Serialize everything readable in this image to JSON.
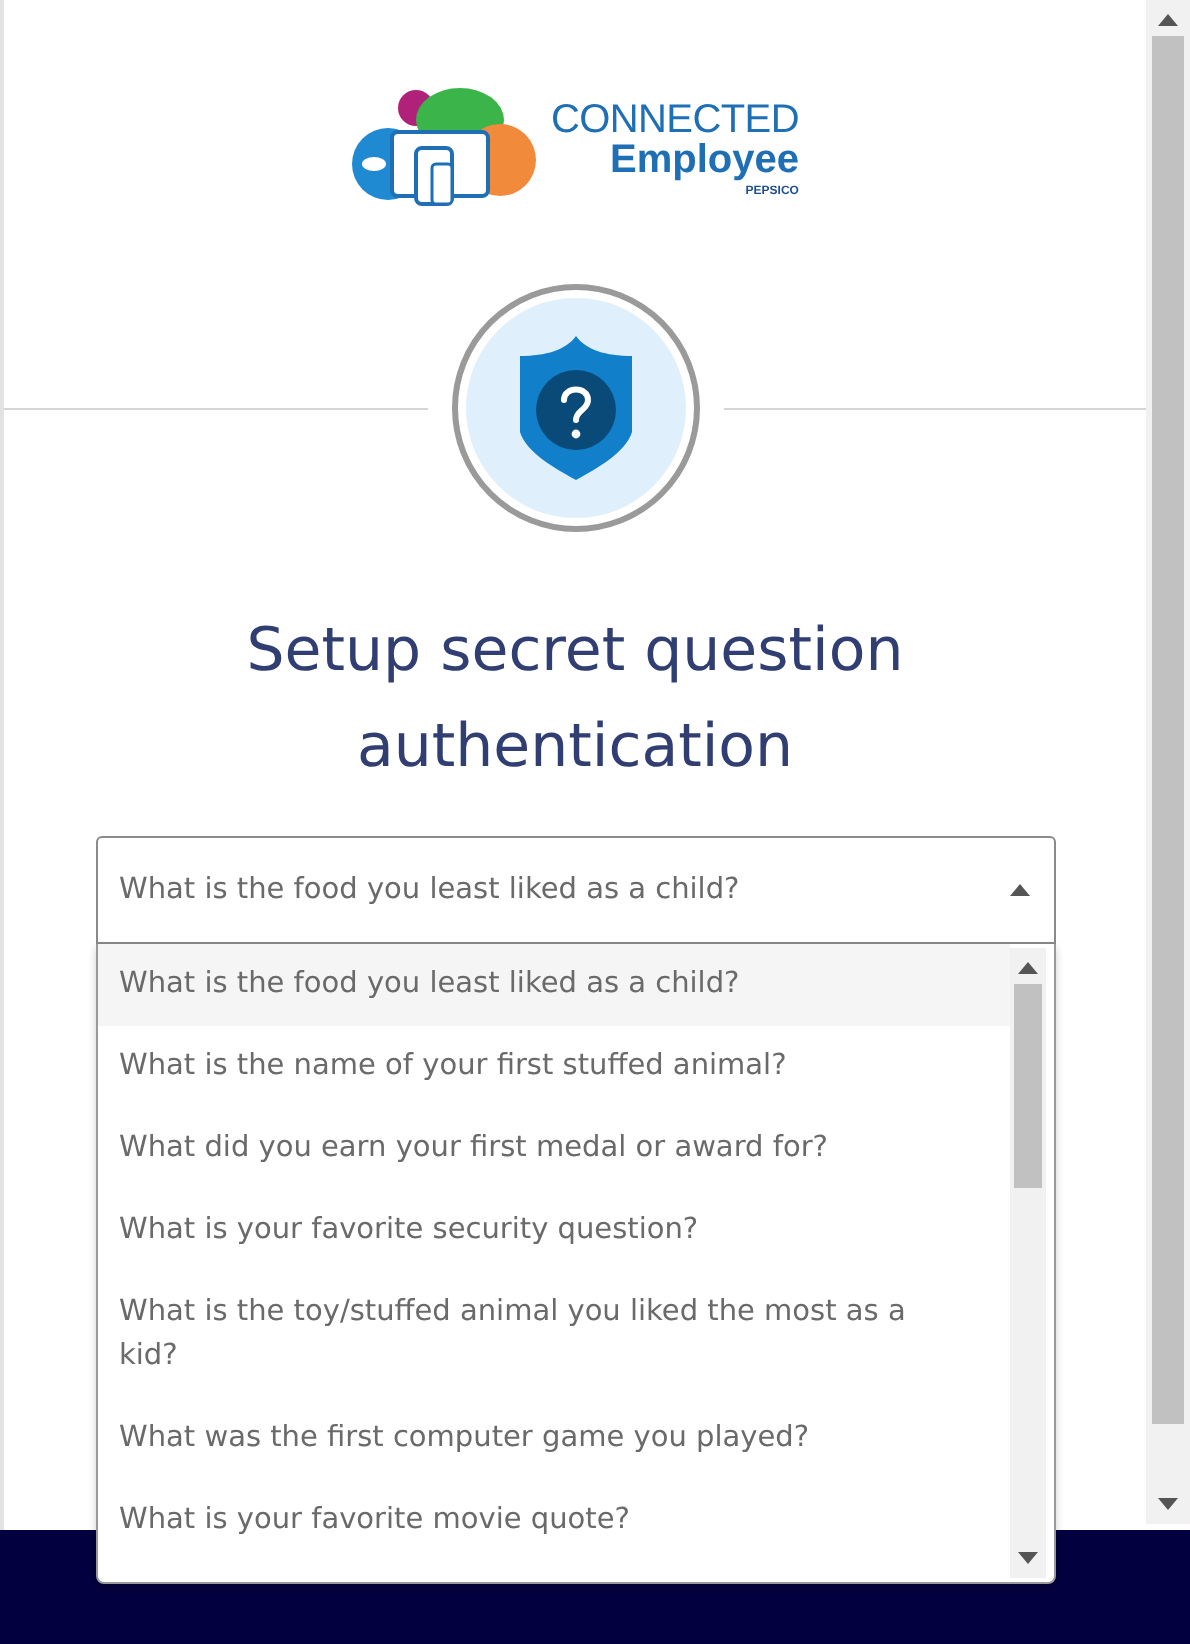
{
  "logo": {
    "line_1": "CONNECTED",
    "line_2": "Employee",
    "brand": "PEPSICO"
  },
  "title": "Setup secret question authentication",
  "question_select": {
    "value": "What is the food you least liked as a child?",
    "expanded": true,
    "options": [
      {
        "label": "What is the food you least liked as a child?",
        "selected": true
      },
      {
        "label": "What is the name of your first stuffed animal?",
        "selected": false
      },
      {
        "label": "What did you earn your first medal or award for?",
        "selected": false
      },
      {
        "label": "What is your favorite security question?",
        "selected": false
      },
      {
        "label": "What is the toy/stuffed animal you liked the most as a kid?",
        "selected": false
      },
      {
        "label": "What was the first computer game you played?",
        "selected": false
      },
      {
        "label": "What is your favorite movie quote?",
        "selected": false
      }
    ]
  }
}
